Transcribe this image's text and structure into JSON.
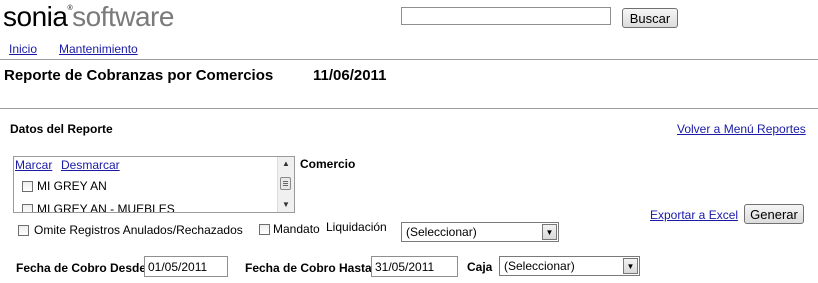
{
  "brand": {
    "name_dark": "sonia",
    "reg_mark": "®",
    "name_light": "software"
  },
  "search": {
    "value": "",
    "button_label": "Buscar"
  },
  "nav": {
    "items": [
      {
        "label": "Inicio"
      },
      {
        "label": "Mantenimiento"
      }
    ]
  },
  "page": {
    "title": "Reporte de Cobranzas por Comercios",
    "date": "11/06/2011"
  },
  "report": {
    "section_label": "Datos del Reporte",
    "back_link": "Volver a Menú Reportes",
    "export_link": "Exportar a Excel",
    "generate_button": "Generar"
  },
  "comercio": {
    "label": "Comercio",
    "mark_link": "Marcar",
    "unmark_link": "Desmarcar",
    "items": [
      {
        "label": "MI GREY AN",
        "checked": false
      },
      {
        "label": "MI GREY AN - MUEBLES",
        "checked": false
      }
    ]
  },
  "options": {
    "omit_label": "Omite Registros Anulados/Rechazados",
    "mandato_label": "Mandato"
  },
  "liquidacion": {
    "label": "Liquidación",
    "selected": "(Seleccionar)"
  },
  "fecha_desde": {
    "label": "Fecha de Cobro Desde",
    "value": "01/05/2011"
  },
  "fecha_hasta": {
    "label": "Fecha de Cobro Hasta",
    "value": "31/05/2011"
  },
  "caja": {
    "label": "Caja",
    "selected": "(Seleccionar)"
  }
}
